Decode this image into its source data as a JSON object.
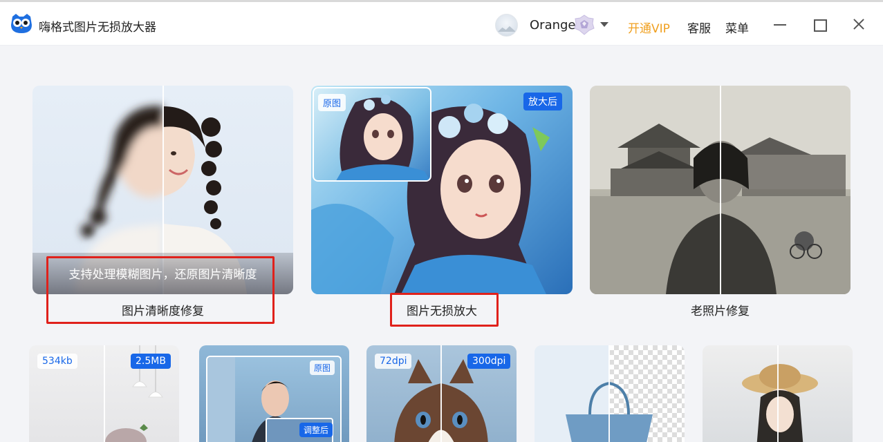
{
  "app": {
    "title": "嗨格式图片无损放大器"
  },
  "user": {
    "name": "Orange"
  },
  "menu": {
    "vip": "开通VIP",
    "service": "客服",
    "menu": "菜单"
  },
  "colors": {
    "accent_blue": "#1867e8",
    "vip_orange": "#f0a020",
    "highlight_red": "#e0211b"
  },
  "cards": [
    {
      "label": "图片清晰度修复",
      "overlay": "支持处理模糊图片，还原图片清晰度"
    },
    {
      "label": "图片无损放大",
      "badge_before": "原图",
      "badge_after": "放大后"
    },
    {
      "label": "老照片修复"
    }
  ],
  "tiles": [
    {
      "left_chip": "534kb",
      "right_chip": "2.5MB"
    },
    {
      "chip_top": "原图",
      "chip_bottom": "调整后"
    },
    {
      "left_chip": "72dpi",
      "right_chip": "300dpi"
    },
    {},
    {}
  ]
}
